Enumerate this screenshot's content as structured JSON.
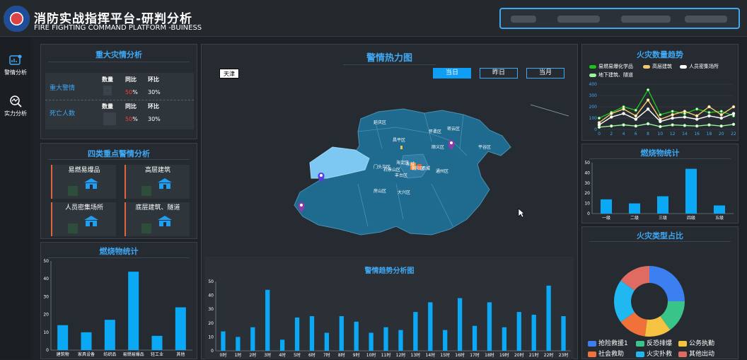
{
  "header": {
    "title": "消防实战指挥平台-研判分析",
    "subtitle": "FIRE FIGHTING COMMAND PLATFORM -BUINESS"
  },
  "sidebar": {
    "items": [
      {
        "label": "警情分析",
        "icon": "alert-chart-icon"
      },
      {
        "label": "实力分析",
        "icon": "analysis-search-icon"
      }
    ]
  },
  "major": {
    "title": "重大灾情分析",
    "rows": [
      {
        "label": "重大警情",
        "h1": "数量",
        "h2": "同比",
        "h3": "环比",
        "yoy_red": "50",
        "yoy_suffix": "%",
        "mom": "30%"
      },
      {
        "label": "死亡人数",
        "h1": "数量",
        "h2": "同比",
        "h3": "环比",
        "yoy_red": "50",
        "yoy_suffix": "%",
        "mom": "30%"
      }
    ]
  },
  "four": {
    "title": "四类重点警情分析",
    "items": [
      "易燃易爆品",
      "高层建筑",
      "人员密集场所",
      "底层建筑、隧道"
    ]
  },
  "burn_left": {
    "title": "燃烧物统计",
    "chart_data": {
      "type": "bar",
      "categories": [
        "建筑物",
        "家具设备",
        "纺织品",
        "易燃易爆品",
        "轻工业",
        "其他"
      ],
      "values": [
        14,
        10,
        17,
        44,
        8,
        24
      ],
      "ylim": [
        0,
        50
      ],
      "yticks": [
        "0",
        "10",
        "20",
        "30",
        "40",
        "50"
      ]
    }
  },
  "heat": {
    "title": "警情热力图",
    "region_btn": "天津",
    "tabs": [
      "当日",
      "昨日",
      "当月"
    ],
    "districts": [
      "延庆区",
      "怀柔区",
      "密云区",
      "昌平区",
      "顺义区",
      "平谷区",
      "门头沟区",
      "海淀区",
      "朝阳区",
      "石景山区",
      "东城",
      "西城",
      "丰台区",
      "通州区",
      "房山区",
      "大兴区"
    ]
  },
  "trend": {
    "title": "警情趋势分析图",
    "chart_data": {
      "type": "bar",
      "categories": [
        "0时",
        "1时",
        "2时",
        "3时",
        "4时",
        "5时",
        "6时",
        "7时",
        "8时",
        "9时",
        "10时",
        "11时",
        "12时",
        "13时",
        "14时",
        "15时",
        "16时",
        "17时",
        "18时",
        "19时",
        "20时",
        "21时",
        "22时",
        "23时"
      ],
      "values": [
        14,
        10,
        17,
        44,
        8,
        24,
        25,
        13,
        25,
        21,
        13,
        17,
        15,
        28,
        35,
        15,
        38,
        18,
        35,
        17,
        28,
        26,
        47,
        25
      ],
      "ylim": [
        0,
        50
      ],
      "yticks": [
        "0",
        "10",
        "20",
        "30",
        "40",
        "50"
      ]
    }
  },
  "fire_count": {
    "title": "火灾数量趋势",
    "legend": [
      "易燃易爆化学品",
      "高层建筑",
      "人员密集场所",
      "地下建筑、隧道"
    ],
    "chart_data": {
      "type": "line",
      "x": [
        0,
        2,
        4,
        6,
        8,
        10,
        12,
        14,
        16,
        18,
        20,
        22
      ],
      "xticks": [
        "0",
        "2",
        "4",
        "6",
        "8",
        "10",
        "12",
        "14",
        "16",
        "18",
        "20",
        "22"
      ],
      "ylim": [
        0,
        400
      ],
      "yticks": [
        "0",
        "100",
        "200",
        "300",
        "400"
      ],
      "series": [
        {
          "name": "易燃易爆化学品",
          "color": "#1ec21e",
          "values": [
            100,
            150,
            200,
            170,
            350,
            130,
            160,
            140,
            180,
            150,
            160,
            120
          ]
        },
        {
          "name": "高层建筑",
          "color": "#f5c96b",
          "values": [
            60,
            140,
            180,
            120,
            260,
            90,
            130,
            160,
            120,
            200,
            130,
            200
          ]
        },
        {
          "name": "人员密集场所",
          "color": "#ffffff",
          "values": [
            40,
            110,
            140,
            90,
            180,
            70,
            100,
            110,
            90,
            120,
            100,
            140
          ]
        },
        {
          "name": "地下建筑、隧道",
          "color": "#9af59a",
          "values": [
            20,
            30,
            40,
            30,
            50,
            25,
            40,
            35,
            30,
            40,
            30,
            45
          ]
        }
      ]
    }
  },
  "burn_right": {
    "title": "燃烧物统计",
    "chart_data": {
      "type": "bar",
      "categories": [
        "一级",
        "二级",
        "三级",
        "四级",
        "五级"
      ],
      "values": [
        14,
        10,
        17,
        44,
        8
      ],
      "ylim": [
        0,
        50
      ],
      "yticks": [
        "0",
        "10",
        "20",
        "30",
        "40",
        "50"
      ]
    }
  },
  "fire_type": {
    "title": "火灾类型占比",
    "chart_data": {
      "type": "pie",
      "slices": [
        {
          "name": "抢险救援1",
          "color": "#3b7ff0",
          "value": 25
        },
        {
          "name": "反恐排爆",
          "color": "#39c48a",
          "value": 15
        },
        {
          "name": "公务执勤",
          "color": "#f5c242",
          "value": 12
        },
        {
          "name": "社会救助",
          "color": "#f0713a",
          "value": 13
        },
        {
          "name": "火灾扑救",
          "color": "#1fb8f0",
          "value": 20
        },
        {
          "name": "其他出动",
          "color": "#e06b63",
          "value": 15
        }
      ]
    }
  }
}
